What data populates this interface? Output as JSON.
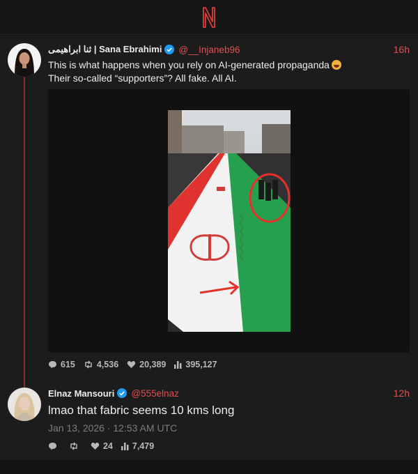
{
  "header": {
    "logo_letter": "N",
    "logo_color": "#e03c3c"
  },
  "tweets": [
    {
      "display_name": "ثنا ابراهیمی | Sana Ebrahimi",
      "verified": true,
      "handle": "@__Injaneb96",
      "time": "16h",
      "text_line1": "This is what happens when you rely on AI-generated propaganda",
      "text_line2": "Their so-called “supporters”? All fake. All AI.",
      "emoji": "rolling-on-floor-laughing",
      "media": "video-of-crowd-holding-giant-iranian-flag",
      "stats": {
        "replies": "615",
        "retweets": "4,536",
        "likes": "20,389",
        "views": "395,127"
      }
    },
    {
      "display_name": "Elnaz Mansouri",
      "verified": true,
      "handle": "@555elnaz",
      "time": "12h",
      "text": "lmao that fabric seems 10 kms long",
      "date": "Jan 13, 2026 · 12:53 AM UTC",
      "stats": {
        "replies": "",
        "retweets": "",
        "likes": "24",
        "views": "7,479"
      }
    }
  ],
  "colors": {
    "accent": "#e05050",
    "background": "#1c1c1c",
    "verified": "#1d9bf0"
  }
}
